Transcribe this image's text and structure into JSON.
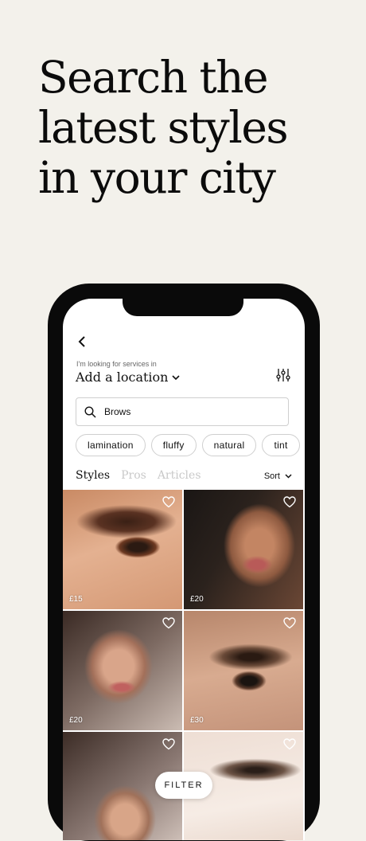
{
  "headline": [
    "Search the",
    "latest styles",
    "in your city"
  ],
  "app": {
    "location_label": "I'm looking for services in",
    "location_value": "Add a location",
    "search": {
      "value": "Brows"
    },
    "chips": [
      "lamination",
      "fluffy",
      "natural",
      "tint"
    ],
    "tabs": [
      "Styles",
      "Pros",
      "Articles"
    ],
    "active_tab": "Styles",
    "sort_label": "Sort",
    "results": [
      {
        "price": "£15"
      },
      {
        "price": "£20"
      },
      {
        "price": "£20"
      },
      {
        "price": "£30"
      },
      {
        "price": ""
      },
      {
        "price": ""
      }
    ],
    "filter_button": "FILTER"
  },
  "colors": {
    "background": "#f3f1eb",
    "phone_frame": "#0a0a0a",
    "inactive_tab": "#c9c9c9"
  },
  "icons": [
    "back-arrow-icon",
    "chevron-down-icon",
    "filter-sliders-icon",
    "search-icon",
    "heart-icon"
  ]
}
